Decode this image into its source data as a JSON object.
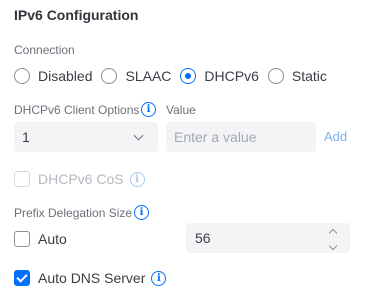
{
  "title": "IPv6 Configuration",
  "connection": {
    "label": "Connection",
    "options": [
      "Disabled",
      "SLAAC",
      "DHCPv6",
      "Static"
    ],
    "selected": "DHCPv6"
  },
  "client_options": {
    "label": "DHCPv6 Client Options",
    "info_icon": "info-icon",
    "select_value": "1",
    "value_label": "Value",
    "value_placeholder": "Enter a value",
    "add_label": "Add"
  },
  "cos": {
    "label": "DHCPv6 CoS",
    "checked": false,
    "disabled": true
  },
  "prefix_delegation": {
    "label": "Prefix Delegation Size",
    "auto_label": "Auto",
    "auto_checked": false,
    "size_value": "56"
  },
  "auto_dns": {
    "label": "Auto DNS Server",
    "checked": true
  },
  "colors": {
    "accent": "#006fff",
    "link_disabled": "#7fb1f5",
    "input_bg": "#f3f4f6"
  }
}
